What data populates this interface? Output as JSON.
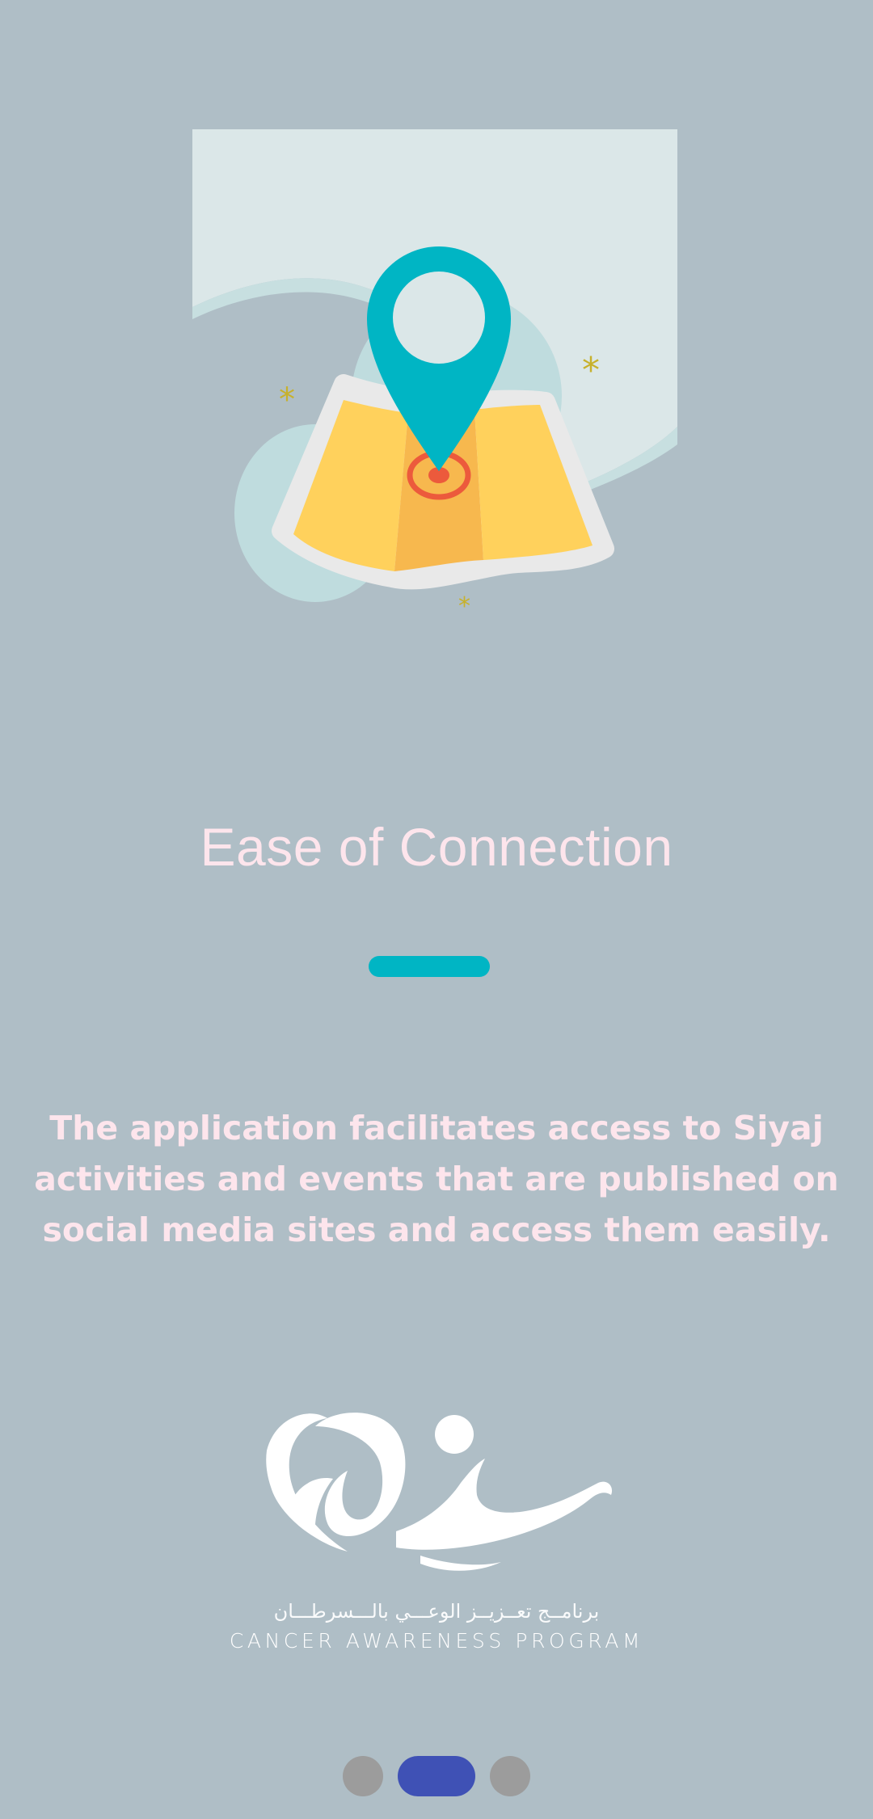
{
  "onboarding": {
    "title": "Ease of Connection",
    "description": "The application facilitates access to Siyaj activities and events that are published on social media sites and access them easily.",
    "illustration_icon": "map-location-pin-icon",
    "accent_color": "#00b5c4",
    "background_color": "#afbec6"
  },
  "logo": {
    "icon": "siyaj-logo-icon",
    "arabic_text": "برنامــج تعــزيــز الوعـــي بالـــسرطـــان",
    "english_text": "CANCER AWARENESS PROGRAM"
  },
  "pager": {
    "total": 3,
    "current": 2,
    "active_color": "#3f51b5",
    "inactive_color": "#9c9c9c"
  }
}
